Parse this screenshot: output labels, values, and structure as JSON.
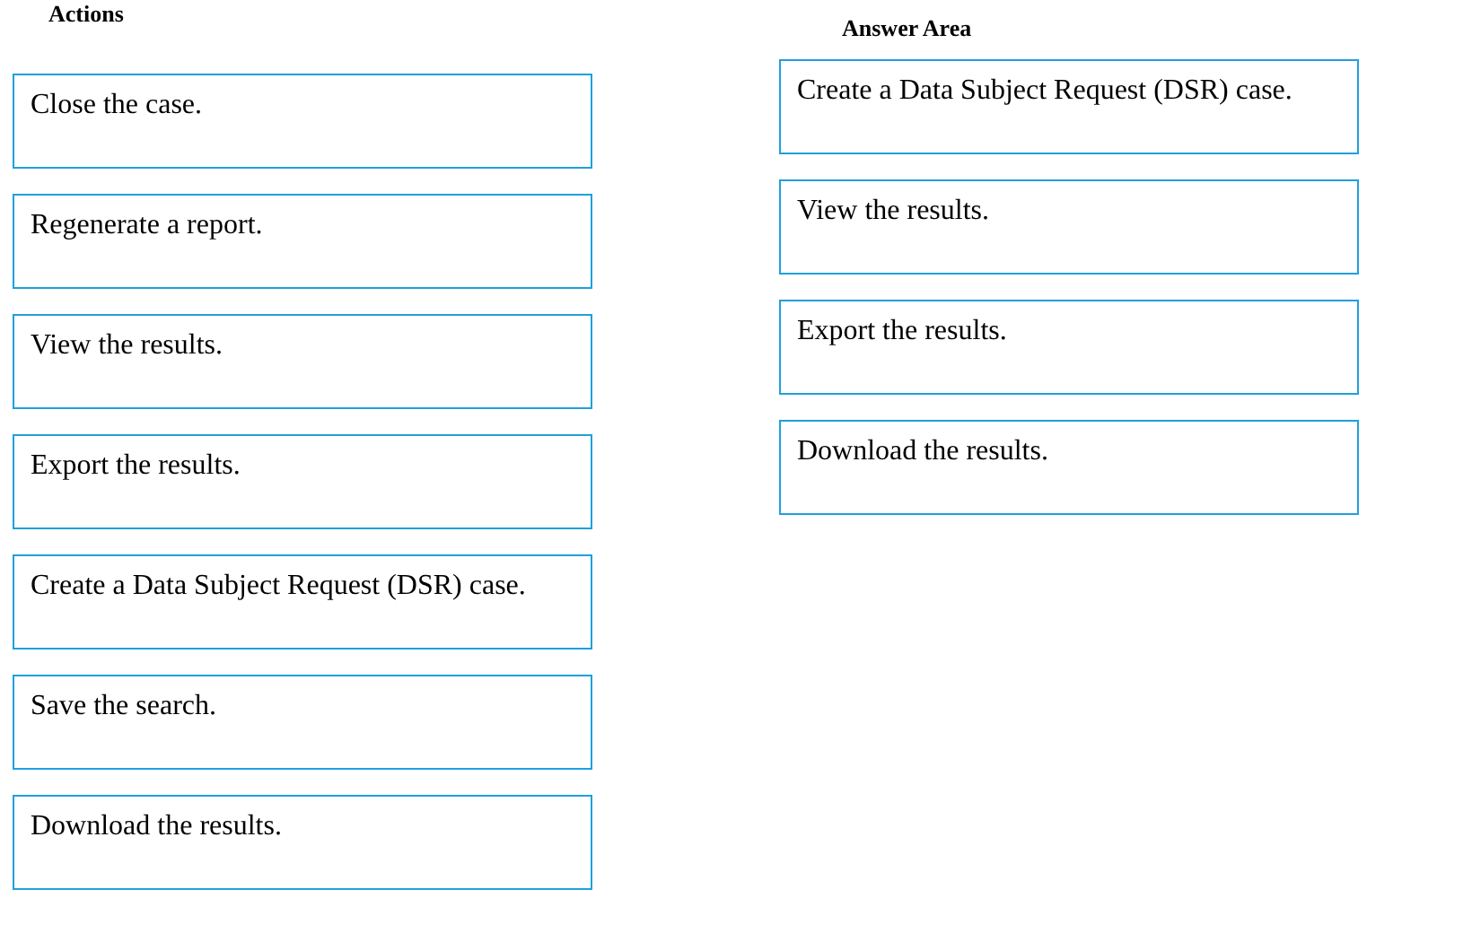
{
  "actions": {
    "title": "Actions",
    "items": [
      {
        "label": "Close the case."
      },
      {
        "label": "Regenerate a report."
      },
      {
        "label": "View the results."
      },
      {
        "label": "Export the results."
      },
      {
        "label": "Create a Data Subject Request (DSR) case."
      },
      {
        "label": "Save the search."
      },
      {
        "label": "Download the results."
      }
    ]
  },
  "answer_area": {
    "title": "Answer Area",
    "items": [
      {
        "label": "Create a Data Subject Request (DSR) case."
      },
      {
        "label": "View the results."
      },
      {
        "label": "Export the results."
      },
      {
        "label": "Download the results."
      }
    ]
  }
}
